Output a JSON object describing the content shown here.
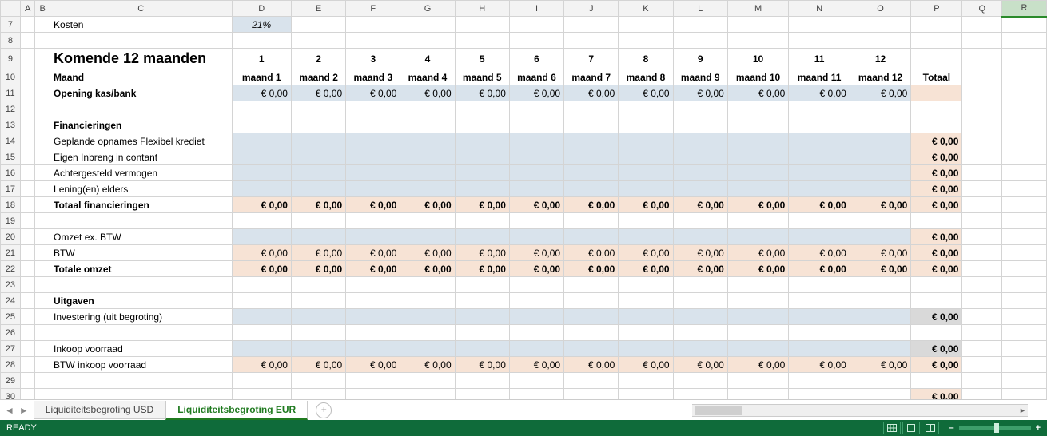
{
  "columns": [
    "A",
    "B",
    "C",
    "D",
    "E",
    "F",
    "G",
    "H",
    "I",
    "J",
    "K",
    "L",
    "M",
    "N",
    "O",
    "P",
    "Q",
    "R"
  ],
  "row_start": 7,
  "row_end": 30,
  "labels": {
    "kosten": "Kosten",
    "kosten_val": "21%",
    "title": "Komende 12 maanden",
    "maand": "Maand",
    "opening": "Opening kas/bank",
    "financieringen": "Financieringen",
    "geplande": "Geplande opnames Flexibel krediet",
    "eigen": "Eigen Inbreng in contant",
    "achter": "Achtergesteld vermogen",
    "lening": "Lening(en) elders",
    "tot_fin": "Totaal financieringen",
    "omzet_ex": "Omzet ex. BTW",
    "btw": "BTW",
    "tot_omzet": "Totale omzet",
    "uitgaven": "Uitgaven",
    "invest": "Investering (uit begroting)",
    "inkoop": "Inkoop voorraad",
    "btw_inkoop": "BTW inkoop voorraad",
    "totaal": "Totaal"
  },
  "month_nums": [
    "1",
    "2",
    "3",
    "4",
    "5",
    "6",
    "7",
    "8",
    "9",
    "10",
    "11",
    "12"
  ],
  "month_names": [
    "maand 1",
    "maand 2",
    "maand 3",
    "maand 4",
    "maand 5",
    "maand 6",
    "maand 7",
    "maand 8",
    "maand 9",
    "maand 10",
    "maand 11",
    "maand 12"
  ],
  "zero": "€ 0,00",
  "tabs": {
    "inactive": "Liquiditeitsbegroting USD",
    "active": "Liquiditeitsbegroting EUR"
  },
  "status": "READY",
  "zoom_minus": "–",
  "zoom_plus": "+",
  "addtab": "+",
  "nav_prev": "◄",
  "nav_next": "►",
  "scroll_left": "◄",
  "scroll_right": "►",
  "selected_col": "R"
}
